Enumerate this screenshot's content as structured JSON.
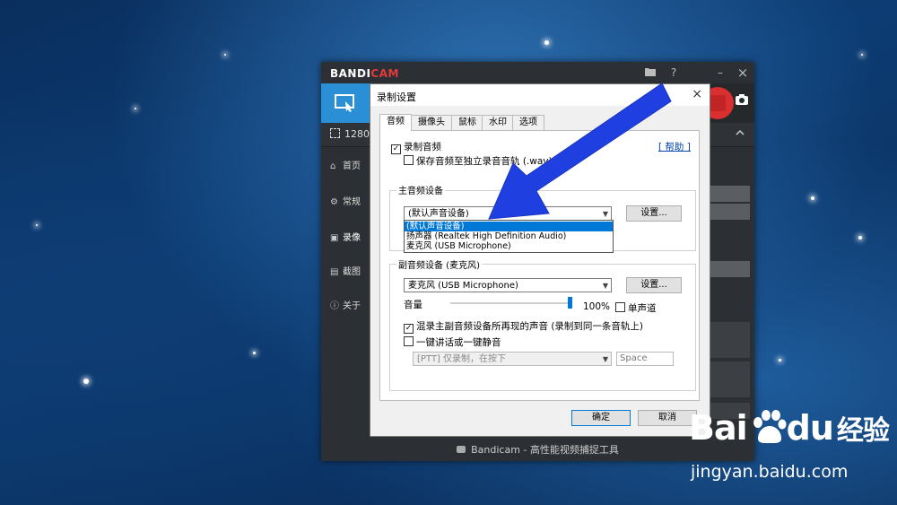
{
  "bandicam": {
    "logo_left": "BANDI",
    "logo_right": "CAM",
    "titlebar_icons": [
      "folder-icon",
      "help-icon",
      "minimize-icon",
      "close-icon"
    ],
    "help_label": "?",
    "minimize_label": "–",
    "close_label": "×",
    "resolution_text": "1280x",
    "sidebar": [
      {
        "icon": "home-icon",
        "label": "首页"
      },
      {
        "icon": "gear-icon",
        "label": "常规"
      },
      {
        "icon": "video-settings-icon",
        "label": "录像"
      },
      {
        "icon": "image-icon",
        "label": "截图"
      },
      {
        "icon": "info-icon",
        "label": "关于"
      }
    ],
    "status_text": "Bandicam - 高性能视频捕捉工具"
  },
  "dialog": {
    "title": "录制设置",
    "close_label": "×",
    "tabs": [
      "音频",
      "摄像头",
      "鼠标",
      "水印",
      "选项"
    ],
    "active_tab": "音频",
    "record_audio_label": "录制音频",
    "record_audio_checked": true,
    "separate_track_label": "保存音频至独立录音音轨 (.wav)",
    "separate_track_checked": false,
    "help_link": "[ 帮助 ]",
    "main_device_group": "主音频设备",
    "main_device_value": "(默认声音设备)",
    "settings_button": "设置...",
    "main_device_options": [
      "(默认声音设备)",
      "扬声器 (Realtek High Definition Audio)",
      "麦克风 (USB Microphone)"
    ],
    "secondary_device_group": "副音频设备 (麦克风)",
    "secondary_device_value": "麦克风 (USB Microphone)",
    "volume_label": "音量",
    "volume_value": "100%",
    "volume_fraction": 1.0,
    "mono_label": "单声道",
    "mono_checked": false,
    "mix_label": "混录主副音频设备所再现的声音 (录制到同一条音轨上)",
    "mix_checked": true,
    "ptt_label": "一键讲话或一键静音",
    "ptt_checked": false,
    "ptt_mode_value": "[PTT] 仅录制，在按下",
    "ptt_key_value": "Space",
    "ok_button": "确定",
    "cancel_button": "取消"
  },
  "watermark": {
    "logo_text_1": "Bai",
    "logo_text_2": "du",
    "logo_text_3": "经验",
    "url": "jingyan.baidu.com"
  },
  "colors": {
    "accent": "#2b8fd6",
    "record_red": "#d92f2f",
    "arrow_blue": "#1f3fe0",
    "selection_blue": "#0078d7"
  }
}
